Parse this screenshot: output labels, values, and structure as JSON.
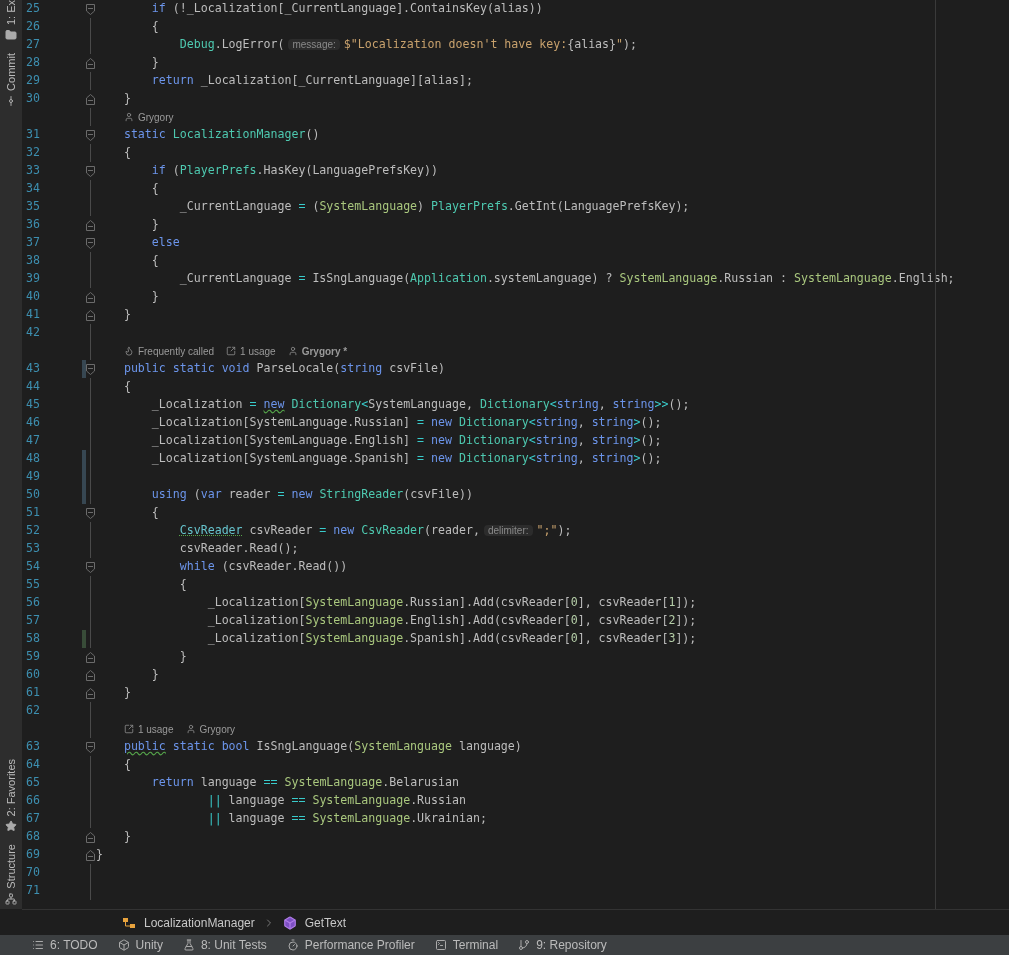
{
  "left_toolbar": {
    "top": [
      {
        "kind": "project",
        "label": "1: Ex"
      },
      {
        "kind": "commit",
        "label": "Commit"
      }
    ],
    "bottom": [
      {
        "kind": "favorites",
        "label": "2: Favorites"
      },
      {
        "kind": "structure",
        "label": "Structure"
      }
    ]
  },
  "editor": {
    "rows": [
      {
        "kind": "group",
        "children": [
          {
            "kind": "group",
            "children": [
              {
                "kind": "code",
                "number": "25",
                "fold_start": true,
                "fold_end": false,
                "modified": false,
                "added": false,
                "tokens": [
                  {
                    "kind": "kw",
                    "text": "if"
                  },
                  {
                    "kind": "plain",
                    "text": " (!_Localization[_CurrentLanguage].ContainsKey(alias))"
                  }
                ]
              },
              {
                "kind": "code",
                "number": "26",
                "fold_start": false,
                "fold_end": false,
                "modified": false,
                "added": false,
                "tokens": [
                  {
                    "kind": "plain",
                    "text": "{"
                  }
                ],
                "children": [
                  {
                    "kind": "code",
                    "number": "27",
                    "fold_start": false,
                    "fold_end": false,
                    "modified": false,
                    "added": false,
                    "tokens": [
                      {
                        "kind": "type",
                        "text": "Debug"
                      },
                      {
                        "kind": "plain",
                        "text": ".LogError("
                      },
                      {
                        "kind": "hint",
                        "text": "message:"
                      },
                      {
                        "kind": "str",
                        "text": "$\"Localization doesn't have key:"
                      },
                      {
                        "kind": "plain",
                        "text": "{alias}"
                      },
                      {
                        "kind": "str",
                        "text": "\""
                      },
                      {
                        "kind": "plain",
                        "text": ");"
                      }
                    ]
                  }
                ]
              },
              {
                "kind": "code",
                "number": "28",
                "fold_start": false,
                "fold_end": true,
                "modified": false,
                "added": false,
                "tokens": [
                  {
                    "kind": "plain",
                    "text": "}"
                  }
                ]
              },
              {
                "kind": "code",
                "number": "29",
                "fold_start": false,
                "fold_end": false,
                "modified": false,
                "added": false,
                "tokens": [
                  {
                    "kind": "kw",
                    "text": "return"
                  },
                  {
                    "kind": "plain",
                    "text": " _Localization[_CurrentLanguage][alias];"
                  }
                ]
              }
            ]
          },
          {
            "kind": "code",
            "number": "30",
            "fold_start": false,
            "fold_end": true,
            "modified": false,
            "added": false,
            "tokens": [
              {
                "kind": "plain",
                "text": "}"
              }
            ]
          },
          {
            "kind": "lens",
            "items": [
              {
                "kind": "author",
                "text": "Grygory",
                "bold": false
              }
            ]
          },
          {
            "kind": "code",
            "number": "31",
            "fold_start": true,
            "fold_end": false,
            "modified": false,
            "added": false,
            "tokens": [
              {
                "kind": "kw",
                "text": "static "
              },
              {
                "kind": "type",
                "text": "LocalizationManager"
              },
              {
                "kind": "plain",
                "text": "()"
              }
            ]
          },
          {
            "kind": "code",
            "number": "32",
            "fold_start": false,
            "fold_end": false,
            "modified": false,
            "added": false,
            "tokens": [
              {
                "kind": "plain",
                "text": "{"
              }
            ],
            "children": [
              {
                "kind": "code",
                "number": "33",
                "fold_start": true,
                "fold_end": false,
                "modified": false,
                "added": false,
                "tokens": [
                  {
                    "kind": "kw",
                    "text": "if"
                  },
                  {
                    "kind": "plain",
                    "text": " ("
                  },
                  {
                    "kind": "type",
                    "text": "PlayerPrefs"
                  },
                  {
                    "kind": "plain",
                    "text": ".HasKey(LanguagePrefsKey))"
                  }
                ]
              },
              {
                "kind": "code",
                "number": "34",
                "fold_start": false,
                "fold_end": false,
                "modified": false,
                "added": false,
                "tokens": [
                  {
                    "kind": "plain",
                    "text": "{"
                  }
                ],
                "children": [
                  {
                    "kind": "code",
                    "number": "35",
                    "fold_start": false,
                    "fold_end": false,
                    "modified": false,
                    "added": false,
                    "tokens": [
                      {
                        "kind": "plain",
                        "text": "_CurrentLanguage "
                      },
                      {
                        "kind": "op",
                        "text": "="
                      },
                      {
                        "kind": "plain",
                        "text": " ("
                      },
                      {
                        "kind": "enum",
                        "text": "SystemLanguage"
                      },
                      {
                        "kind": "plain",
                        "text": ") "
                      },
                      {
                        "kind": "type",
                        "text": "PlayerPrefs"
                      },
                      {
                        "kind": "plain",
                        "text": ".GetInt(LanguagePrefsKey);"
                      }
                    ]
                  }
                ]
              },
              {
                "kind": "code",
                "number": "36",
                "fold_start": false,
                "fold_end": true,
                "modified": false,
                "added": false,
                "tokens": [
                  {
                    "kind": "plain",
                    "text": "}"
                  }
                ]
              },
              {
                "kind": "code",
                "number": "37",
                "fold_start": true,
                "fold_end": false,
                "modified": false,
                "added": false,
                "tokens": [
                  {
                    "kind": "kw",
                    "text": "else"
                  }
                ]
              },
              {
                "kind": "code",
                "number": "38",
                "fold_start": false,
                "fold_end": false,
                "modified": false,
                "added": false,
                "tokens": [
                  {
                    "kind": "plain",
                    "text": "{"
                  }
                ],
                "children": [
                  {
                    "kind": "code",
                    "number": "39",
                    "fold_start": false,
                    "fold_end": false,
                    "modified": false,
                    "added": false,
                    "tokens": [
                      {
                        "kind": "plain",
                        "text": "_CurrentLanguage "
                      },
                      {
                        "kind": "op",
                        "text": "="
                      },
                      {
                        "kind": "plain",
                        "text": " IsSngLanguage("
                      },
                      {
                        "kind": "type",
                        "text": "Application"
                      },
                      {
                        "kind": "plain",
                        "text": ".systemLanguage) ? "
                      },
                      {
                        "kind": "enum",
                        "text": "SystemLanguage"
                      },
                      {
                        "kind": "plain",
                        "text": ".Russian : "
                      },
                      {
                        "kind": "enum",
                        "text": "SystemLanguage"
                      },
                      {
                        "kind": "plain",
                        "text": ".English;"
                      }
                    ]
                  }
                ]
              },
              {
                "kind": "code",
                "number": "40",
                "fold_start": false,
                "fold_end": true,
                "modified": false,
                "added": false,
                "tokens": [
                  {
                    "kind": "plain",
                    "text": "}"
                  }
                ]
              }
            ]
          },
          {
            "kind": "code",
            "number": "41",
            "fold_start": false,
            "fold_end": true,
            "modified": false,
            "added": false,
            "tokens": [
              {
                "kind": "plain",
                "text": "}"
              }
            ]
          },
          {
            "kind": "code",
            "number": "42",
            "fold_start": false,
            "fold_end": false,
            "modified": false,
            "added": false
          },
          {
            "kind": "lens",
            "items": [
              {
                "kind": "calls",
                "text": "Frequently called",
                "bold": false
              },
              {
                "kind": "usages",
                "text": "1 usage",
                "bold": false
              },
              {
                "kind": "author",
                "text": "Grygory *",
                "bold": true
              }
            ]
          },
          {
            "kind": "code",
            "number": "43",
            "fold_start": true,
            "fold_end": false,
            "modified": true,
            "added": false,
            "tokens": [
              {
                "kind": "kw",
                "text": "public static void"
              },
              {
                "kind": "plain",
                "text": " ParseLocale("
              },
              {
                "kind": "kw",
                "text": "string"
              },
              {
                "kind": "plain",
                "text": " csvFile)"
              }
            ]
          },
          {
            "kind": "code",
            "number": "44",
            "fold_start": false,
            "fold_end": false,
            "modified": false,
            "added": false,
            "tokens": [
              {
                "kind": "plain",
                "text": "{"
              }
            ],
            "children": [
              {
                "kind": "code",
                "number": "45",
                "fold_start": false,
                "fold_end": false,
                "modified": false,
                "added": false,
                "tokens": [
                  {
                    "kind": "plain",
                    "text": "_Localization "
                  },
                  {
                    "kind": "op",
                    "text": "= "
                  },
                  {
                    "kind": "kw_warn",
                    "text": "new"
                  },
                  {
                    "kind": "type",
                    "text": " Dictionary"
                  },
                  {
                    "kind": "op",
                    "text": "<"
                  },
                  {
                    "kind": "plain",
                    "text": "SystemLanguage, "
                  },
                  {
                    "kind": "type",
                    "text": "Dictionary"
                  },
                  {
                    "kind": "op",
                    "text": "<"
                  },
                  {
                    "kind": "kw",
                    "text": "string"
                  },
                  {
                    "kind": "plain",
                    "text": ", "
                  },
                  {
                    "kind": "kw",
                    "text": "string"
                  },
                  {
                    "kind": "op",
                    "text": ">>"
                  },
                  {
                    "kind": "plain",
                    "text": "();"
                  }
                ]
              },
              {
                "kind": "code",
                "number": "46",
                "fold_start": false,
                "fold_end": false,
                "modified": false,
                "added": false,
                "tokens": [
                  {
                    "kind": "plain",
                    "text": "_Localization[SystemLanguage.Russian] "
                  },
                  {
                    "kind": "op",
                    "text": "= "
                  },
                  {
                    "kind": "kw",
                    "text": "new "
                  },
                  {
                    "kind": "type",
                    "text": "Dictionary"
                  },
                  {
                    "kind": "op",
                    "text": "<"
                  },
                  {
                    "kind": "kw",
                    "text": "string"
                  },
                  {
                    "kind": "plain",
                    "text": ", "
                  },
                  {
                    "kind": "kw",
                    "text": "string"
                  },
                  {
                    "kind": "op",
                    "text": ">"
                  },
                  {
                    "kind": "plain",
                    "text": "();"
                  }
                ]
              },
              {
                "kind": "code",
                "number": "47",
                "fold_start": false,
                "fold_end": false,
                "modified": false,
                "added": false,
                "tokens": [
                  {
                    "kind": "plain",
                    "text": "_Localization[SystemLanguage.English] "
                  },
                  {
                    "kind": "op",
                    "text": "= "
                  },
                  {
                    "kind": "kw",
                    "text": "new "
                  },
                  {
                    "kind": "type",
                    "text": "Dictionary"
                  },
                  {
                    "kind": "op",
                    "text": "<"
                  },
                  {
                    "kind": "kw",
                    "text": "string"
                  },
                  {
                    "kind": "plain",
                    "text": ", "
                  },
                  {
                    "kind": "kw",
                    "text": "string"
                  },
                  {
                    "kind": "op",
                    "text": ">"
                  },
                  {
                    "kind": "plain",
                    "text": "();"
                  }
                ]
              },
              {
                "kind": "code",
                "number": "48",
                "fold_start": false,
                "fold_end": false,
                "modified": true,
                "added": false,
                "tokens": [
                  {
                    "kind": "plain",
                    "text": "_Localization[SystemLanguage.Spanish] "
                  },
                  {
                    "kind": "op",
                    "text": "= "
                  },
                  {
                    "kind": "kw",
                    "text": "new "
                  },
                  {
                    "kind": "type",
                    "text": "Dictionary"
                  },
                  {
                    "kind": "op",
                    "text": "<"
                  },
                  {
                    "kind": "kw",
                    "text": "string"
                  },
                  {
                    "kind": "plain",
                    "text": ", "
                  },
                  {
                    "kind": "kw",
                    "text": "string"
                  },
                  {
                    "kind": "op",
                    "text": ">"
                  },
                  {
                    "kind": "plain",
                    "text": "();"
                  }
                ]
              },
              {
                "kind": "code",
                "number": "49",
                "fold_start": false,
                "fold_end": false,
                "modified": true,
                "added": false
              },
              {
                "kind": "code",
                "number": "50",
                "fold_start": false,
                "fold_end": false,
                "modified": true,
                "added": false,
                "tokens": [
                  {
                    "kind": "kw",
                    "text": "using"
                  },
                  {
                    "kind": "plain",
                    "text": " ("
                  },
                  {
                    "kind": "kw",
                    "text": "var"
                  },
                  {
                    "kind": "plain",
                    "text": " reader "
                  },
                  {
                    "kind": "op",
                    "text": "= "
                  },
                  {
                    "kind": "kw",
                    "text": "new "
                  },
                  {
                    "kind": "type",
                    "text": "StringReader"
                  },
                  {
                    "kind": "plain",
                    "text": "(csvFile))"
                  }
                ]
              },
              {
                "kind": "code",
                "number": "51",
                "fold_start": true,
                "fold_end": false,
                "modified": false,
                "added": false,
                "tokens": [
                  {
                    "kind": "plain",
                    "text": "{"
                  }
                ],
                "children": [
                  {
                    "kind": "code",
                    "number": "52",
                    "fold_start": false,
                    "fold_end": false,
                    "modified": false,
                    "added": false,
                    "tokens": [
                      {
                        "kind": "type_warn",
                        "text": "CsvReader"
                      },
                      {
                        "kind": "plain",
                        "text": " csvReader "
                      },
                      {
                        "kind": "op",
                        "text": "= "
                      },
                      {
                        "kind": "kw",
                        "text": "new "
                      },
                      {
                        "kind": "type",
                        "text": "CsvReader"
                      },
                      {
                        "kind": "plain",
                        "text": "(reader,"
                      },
                      {
                        "kind": "hint",
                        "text": "delimiter:"
                      },
                      {
                        "kind": "str",
                        "text": "\";\""
                      },
                      {
                        "kind": "plain",
                        "text": ");"
                      }
                    ]
                  },
                  {
                    "kind": "code",
                    "number": "53",
                    "fold_start": false,
                    "fold_end": false,
                    "modified": false,
                    "added": false,
                    "tokens": [
                      {
                        "kind": "plain",
                        "text": "csvReader.Read();"
                      }
                    ]
                  },
                  {
                    "kind": "code",
                    "number": "54",
                    "fold_start": true,
                    "fold_end": false,
                    "modified": false,
                    "added": false,
                    "tokens": [
                      {
                        "kind": "kw",
                        "text": "while"
                      },
                      {
                        "kind": "plain",
                        "text": " (csvReader.Read())"
                      }
                    ]
                  },
                  {
                    "kind": "code",
                    "number": "55",
                    "fold_start": false,
                    "fold_end": false,
                    "modified": false,
                    "added": false,
                    "tokens": [
                      {
                        "kind": "plain",
                        "text": "{"
                      }
                    ],
                    "children": [
                      {
                        "kind": "code",
                        "number": "56",
                        "fold_start": false,
                        "fold_end": false,
                        "modified": false,
                        "added": false,
                        "tokens": [
                          {
                            "kind": "plain",
                            "text": "_Localization["
                          },
                          {
                            "kind": "enum",
                            "text": "SystemLanguage"
                          },
                          {
                            "kind": "plain",
                            "text": ".Russian].Add(csvReader["
                          },
                          {
                            "kind": "num",
                            "text": "0"
                          },
                          {
                            "kind": "plain",
                            "text": "], csvReader["
                          },
                          {
                            "kind": "num",
                            "text": "1"
                          },
                          {
                            "kind": "plain",
                            "text": "]);"
                          }
                        ]
                      },
                      {
                        "kind": "code",
                        "number": "57",
                        "fold_start": false,
                        "fold_end": false,
                        "modified": false,
                        "added": false,
                        "tokens": [
                          {
                            "kind": "plain",
                            "text": "_Localization["
                          },
                          {
                            "kind": "enum",
                            "text": "SystemLanguage"
                          },
                          {
                            "kind": "plain",
                            "text": ".English].Add(csvReader["
                          },
                          {
                            "kind": "num",
                            "text": "0"
                          },
                          {
                            "kind": "plain",
                            "text": "], csvReader["
                          },
                          {
                            "kind": "num",
                            "text": "2"
                          },
                          {
                            "kind": "plain",
                            "text": "]);"
                          }
                        ]
                      },
                      {
                        "kind": "code",
                        "number": "58",
                        "fold_start": false,
                        "fold_end": false,
                        "modified": false,
                        "added": true,
                        "tokens": [
                          {
                            "kind": "plain",
                            "text": "_Localization["
                          },
                          {
                            "kind": "enum",
                            "text": "SystemLanguage"
                          },
                          {
                            "kind": "plain",
                            "text": ".Spanish].Add(csvReader["
                          },
                          {
                            "kind": "num",
                            "text": "0"
                          },
                          {
                            "kind": "plain",
                            "text": "], csvReader["
                          },
                          {
                            "kind": "num",
                            "text": "3"
                          },
                          {
                            "kind": "plain",
                            "text": "]);"
                          }
                        ]
                      }
                    ]
                  },
                  {
                    "kind": "code",
                    "number": "59",
                    "fold_start": false,
                    "fold_end": true,
                    "modified": false,
                    "added": false,
                    "tokens": [
                      {
                        "kind": "plain",
                        "text": "}"
                      }
                    ]
                  }
                ]
              },
              {
                "kind": "code",
                "number": "60",
                "fold_start": false,
                "fold_end": true,
                "modified": false,
                "added": false,
                "tokens": [
                  {
                    "kind": "plain",
                    "text": "}"
                  }
                ]
              }
            ]
          },
          {
            "kind": "code",
            "number": "61",
            "fold_start": false,
            "fold_end": true,
            "modified": false,
            "added": false,
            "tokens": [
              {
                "kind": "plain",
                "text": "}"
              }
            ]
          },
          {
            "kind": "code",
            "number": "62",
            "fold_start": false,
            "fold_end": false,
            "modified": false,
            "added": false
          },
          {
            "kind": "lens",
            "items": [
              {
                "kind": "usages",
                "text": "1 usage",
                "bold": false
              },
              {
                "kind": "author",
                "text": "Grygory",
                "bold": false
              }
            ]
          },
          {
            "kind": "code",
            "number": "63",
            "fold_start": true,
            "fold_end": false,
            "modified": false,
            "added": false,
            "tokens": [
              {
                "kind": "kw_warn",
                "text": "public"
              },
              {
                "kind": "kw",
                "text": " static bool"
              },
              {
                "kind": "plain",
                "text": " IsSngLanguage("
              },
              {
                "kind": "enum",
                "text": "SystemLanguage"
              },
              {
                "kind": "plain",
                "text": " language)"
              }
            ]
          },
          {
            "kind": "code",
            "number": "64",
            "fold_start": false,
            "fold_end": false,
            "modified": false,
            "added": false,
            "tokens": [
              {
                "kind": "plain",
                "text": "{"
              }
            ],
            "children": [
              {
                "kind": "code",
                "number": "65",
                "fold_start": false,
                "fold_end": false,
                "modified": false,
                "added": false,
                "tokens": [
                  {
                    "kind": "kw",
                    "text": "return"
                  },
                  {
                    "kind": "plain",
                    "text": " language "
                  },
                  {
                    "kind": "op",
                    "text": "== "
                  },
                  {
                    "kind": "enum",
                    "text": "SystemLanguage"
                  },
                  {
                    "kind": "plain",
                    "text": ".Belarusian"
                  }
                ],
                "children": [
                  {
                    "kind": "group",
                    "children": [
                      {
                        "kind": "code",
                        "number": "66",
                        "fold_start": false,
                        "fold_end": false,
                        "modified": false,
                        "added": false,
                        "tokens": [
                          {
                            "kind": "op",
                            "text": "||"
                          },
                          {
                            "kind": "plain",
                            "text": " language "
                          },
                          {
                            "kind": "op",
                            "text": "== "
                          },
                          {
                            "kind": "enum",
                            "text": "SystemLanguage"
                          },
                          {
                            "kind": "plain",
                            "text": ".Russian"
                          }
                        ]
                      },
                      {
                        "kind": "code",
                        "number": "67",
                        "fold_start": false,
                        "fold_end": false,
                        "modified": false,
                        "added": false,
                        "tokens": [
                          {
                            "kind": "op",
                            "text": "||"
                          },
                          {
                            "kind": "plain",
                            "text": " language "
                          },
                          {
                            "kind": "op",
                            "text": "== "
                          },
                          {
                            "kind": "enum",
                            "text": "SystemLanguage"
                          },
                          {
                            "kind": "plain",
                            "text": ".Ukrainian;"
                          }
                        ]
                      }
                    ]
                  }
                ]
              }
            ]
          },
          {
            "kind": "code",
            "number": "68",
            "fold_start": false,
            "fold_end": true,
            "modified": false,
            "added": false,
            "tokens": [
              {
                "kind": "plain",
                "text": "}"
              }
            ]
          }
        ]
      },
      {
        "kind": "code",
        "number": "69",
        "fold_start": false,
        "fold_end": true,
        "modified": false,
        "added": false,
        "tokens": [
          {
            "kind": "plain",
            "text": "}"
          }
        ]
      },
      {
        "kind": "code",
        "number": "70",
        "fold_start": false,
        "fold_end": false,
        "modified": false,
        "added": false
      },
      {
        "kind": "code",
        "number": "71",
        "fold_start": false,
        "fold_end": false,
        "modified": false,
        "added": false
      }
    ]
  },
  "breadcrumbs": [
    {
      "kind": "class",
      "text": "LocalizationManager"
    },
    {
      "kind": "method",
      "text": "GetText"
    }
  ],
  "tool_windows": [
    {
      "kind": "todo",
      "label": "6: TODO"
    },
    {
      "kind": "unity",
      "label": "Unity"
    },
    {
      "kind": "tests",
      "label": "8: Unit Tests"
    },
    {
      "kind": "profiler",
      "label": "Performance Profiler"
    },
    {
      "kind": "terminal",
      "label": "Terminal"
    },
    {
      "kind": "repository",
      "label": "9: Repository"
    }
  ]
}
